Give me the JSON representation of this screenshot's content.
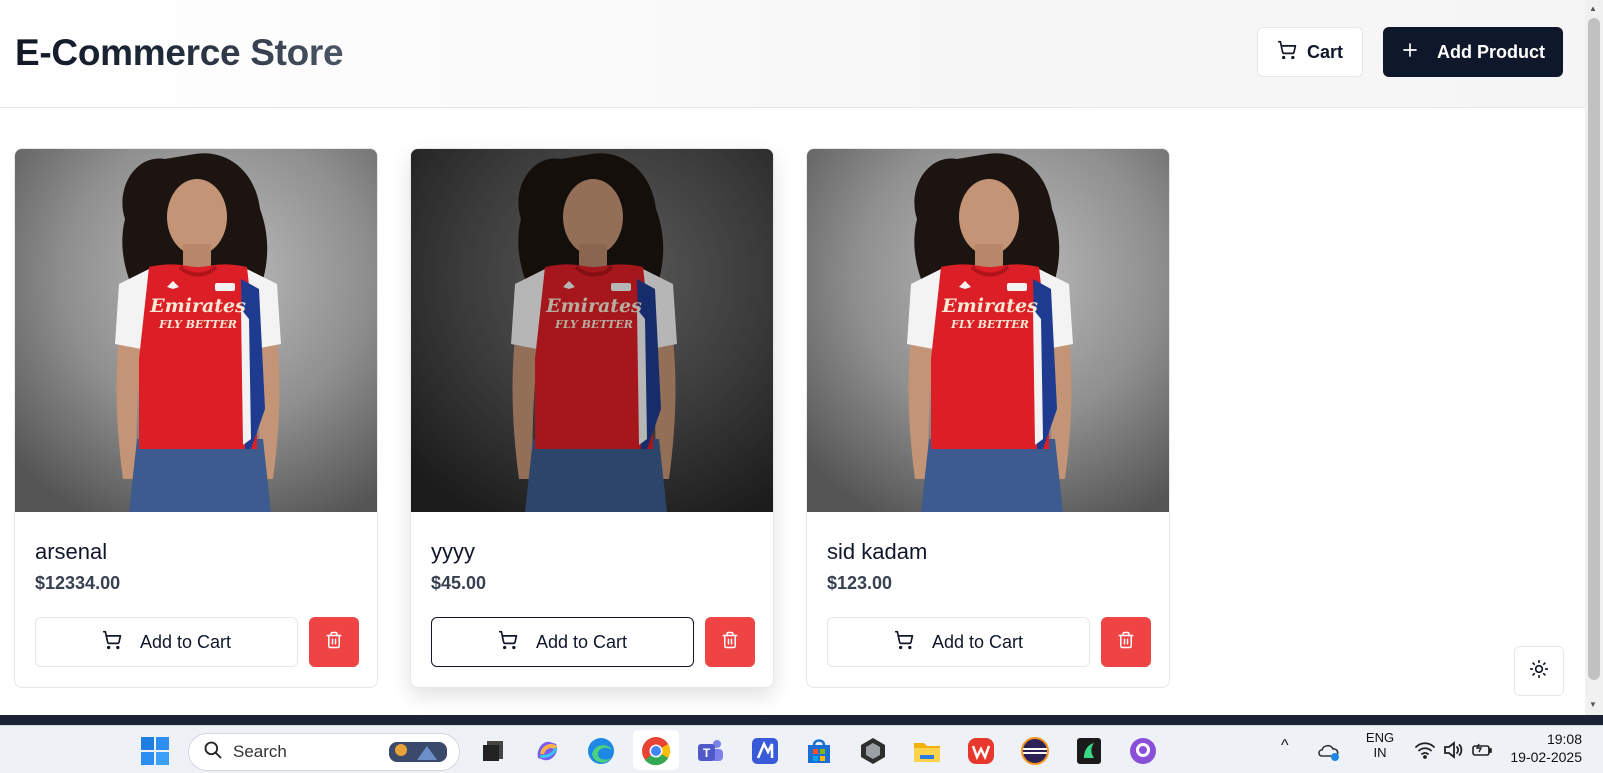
{
  "header": {
    "title": "E-Commerce Store",
    "cart_label": "Cart",
    "add_product_label": "Add Product"
  },
  "products": [
    {
      "name": "arsenal",
      "price": "$12334.00",
      "add_to_cart_label": "Add to Cart",
      "image": "red-football-jersey-model"
    },
    {
      "name": "yyyy",
      "price": "$45.00",
      "add_to_cart_label": "Add to Cart",
      "image": "red-football-jersey-model"
    },
    {
      "name": "sid kadam",
      "price": "$123.00",
      "add_to_cart_label": "Add to Cart",
      "image": "red-football-jersey-model"
    }
  ],
  "jersey_print": {
    "line1": "Emirates",
    "line2": "FLY BETTER"
  },
  "colors": {
    "primary": "#0f172a",
    "danger": "#ef4444",
    "border": "#e5e7eb"
  },
  "taskbar": {
    "search_placeholder": "Search",
    "apps": [
      "start",
      "search",
      "task-view",
      "copilot",
      "edge",
      "chrome",
      "teams",
      "zoho",
      "store",
      "obs",
      "file-explorer",
      "wps",
      "eclipse",
      "app-green",
      "github-desktop"
    ],
    "language_line1": "ENG",
    "language_line2": "IN",
    "time": "19:08",
    "date": "19-02-2025"
  }
}
